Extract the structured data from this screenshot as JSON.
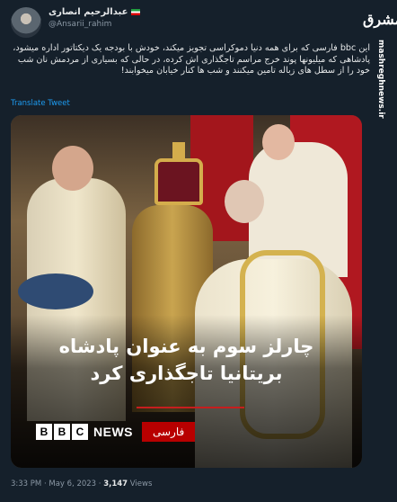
{
  "tweet": {
    "display_name": "عبدالرحیم انصاری",
    "handle": "@Ansarii_rahim",
    "body": "این bbc فارسی که برای همه دنیا دموکراسی تجویز میکند، خودش با بودجه یک دیکتاتور اداره میشود، پادشاهی که میلیونها پوند خرج مراسم تاجگذاری اش کرده، در حالی که بسیاری از مردمش نان شب خود را از سطل های زباله تامین میکنند و شب ها کنار خیابان میخوابند!",
    "translate_label": "Translate Tweet",
    "time": "3:33 PM",
    "separator": "·",
    "date": "May 6, 2023",
    "views_count": "3,147",
    "views_label": "Views"
  },
  "watermark": {
    "logo_text": "مشرق",
    "url": "mashreghnews.ir"
  },
  "media": {
    "headline_line1": "چارلز سوم به عنوان پادشاه",
    "headline_line2": "بریتانیا تاجگذاری کرد",
    "bbc_letters": [
      "B",
      "B",
      "C"
    ],
    "bbc_news": "NEWS",
    "bbc_persian": "فارسی"
  },
  "colors": {
    "background": "#15202b",
    "link": "#1d9bf0",
    "bbc_red": "#b80000"
  },
  "icons": {
    "flag": "iran-flag-icon"
  }
}
